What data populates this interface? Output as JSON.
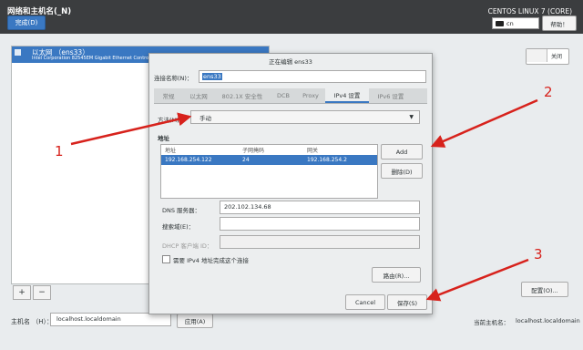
{
  "topbar": {
    "title": "网络和主机名(_N)",
    "done_label": "完成(D)",
    "os_label": "CENTOS LINUX 7 (CORE)",
    "keyboard_layout": "cn",
    "help_label": "帮助！"
  },
  "interfaces": {
    "items": [
      {
        "name": "以太网 （ens33）",
        "description": "Intel Corporation 82545EM Gigabit Ethernet Controller (Copper)"
      }
    ],
    "add_label": "+",
    "remove_label": "−"
  },
  "background": {
    "toggle_label": "关闭",
    "config_label": "配置(O)...",
    "hostname_label": "主机名 （H）：",
    "hostname_value": "localhost.localdomain",
    "apply_label": "应用(A)",
    "current_host_label": "当前主机名：",
    "current_host_value": "localhost.localdomain"
  },
  "dialog": {
    "title": "正在编辑 ens33",
    "connection_name_label": "连接名称(N)：",
    "connection_name_value": "ens33",
    "tabs": [
      {
        "label": "常规"
      },
      {
        "label": "以太网"
      },
      {
        "label": "802.1X 安全性"
      },
      {
        "label": "DCB"
      },
      {
        "label": "Proxy"
      },
      {
        "label": "IPv4 设置",
        "active": true
      },
      {
        "label": "IPv6 设置"
      }
    ],
    "method_label": "方法(M)：",
    "method_value": "手动",
    "address_heading": "地址",
    "address_columns": [
      "地址",
      "子网掩码",
      "网关"
    ],
    "address_rows": [
      {
        "address": "192.168.254.122",
        "netmask": "24",
        "gateway": "192.168.254.2"
      }
    ],
    "add_label": "Add",
    "delete_label": "删除(D)",
    "dns_label": "DNS 服务器：",
    "dns_value": "202.102.134.68",
    "search_label": "搜索域(E)：",
    "search_value": "",
    "dhcp_label": "DHCP 客户端 ID：",
    "dhcp_value": "",
    "require_label": "需要 IPv4 地址完成这个连接",
    "routes_label": "路由(R)...",
    "cancel_label": "Cancel",
    "save_label": "保存(S)"
  },
  "annotations": {
    "labels": [
      "1",
      "2",
      "3"
    ],
    "color": "#d7221c"
  }
}
